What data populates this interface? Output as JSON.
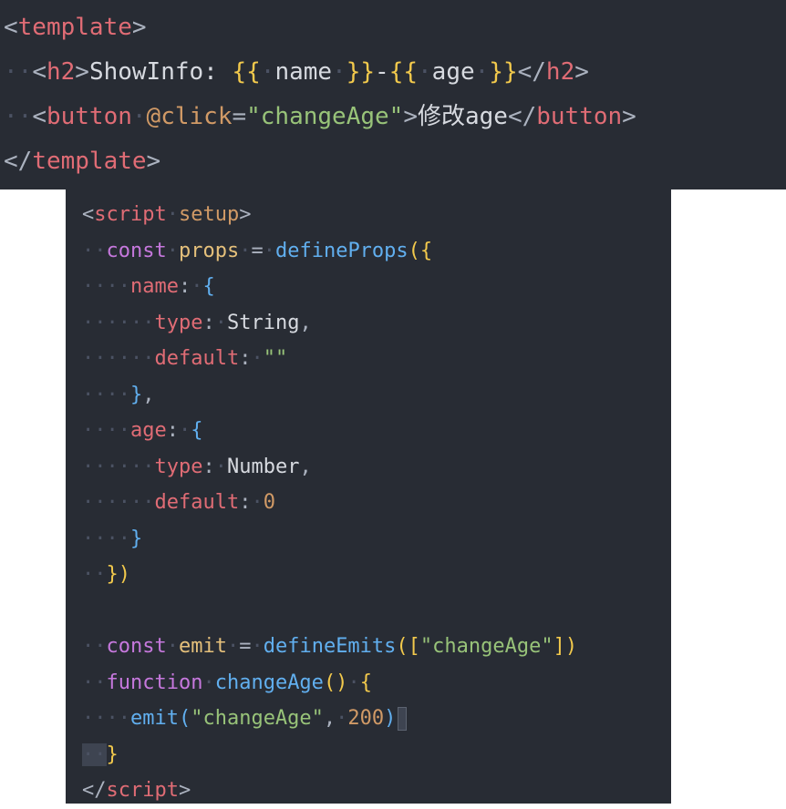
{
  "template_code": {
    "open_tag": "template",
    "h2_tag": "h2",
    "h2_text": "ShowInfo: ",
    "name_var": "name",
    "sep": "-",
    "age_var": "age",
    "button_tag": "button",
    "click_attr": "@click",
    "click_value": "\"changeAge\"",
    "button_text": "修改age"
  },
  "script_code": {
    "script_tag": "script",
    "setup_attr": "setup",
    "const_kw": "const",
    "props_var": "props",
    "define_props": "defineProps",
    "name_key": "name",
    "type_key": "type",
    "string_type": "String",
    "default_key": "default",
    "empty_str": "\"\"",
    "age_key": "age",
    "number_type": "Number",
    "zero": "0",
    "emit_var": "emit",
    "define_emits": "defineEmits",
    "change_age_str": "\"changeAge\"",
    "function_kw": "function",
    "change_age_fn": "changeAge",
    "emit_call": "emit",
    "arg_200": "200"
  },
  "colors": {
    "editor_bg": "#282c34",
    "tag": "#e06c75",
    "keyword": "#c678dd",
    "function": "#61afef",
    "string": "#98c379",
    "number": "#d19a66",
    "brace": "#f2c94c"
  }
}
